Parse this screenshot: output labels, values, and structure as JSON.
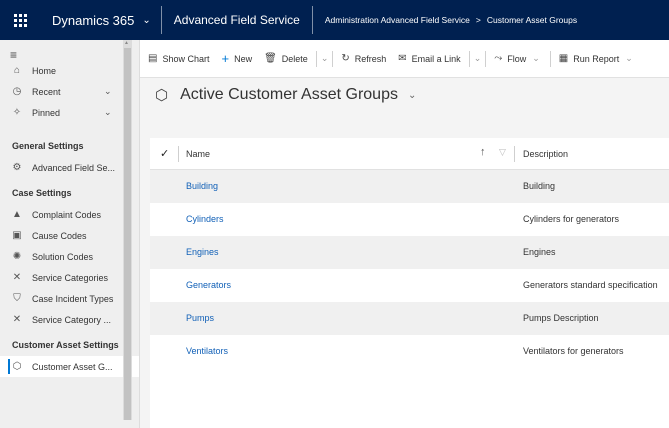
{
  "topbar": {
    "brand": "Dynamics 365",
    "brand_chevron": "⌄",
    "app_name": "Advanced Field Service",
    "breadcrumb": [
      "Administration Advanced Field Service",
      "Customer Asset Groups"
    ],
    "breadcrumb_separator": ">"
  },
  "command_bar": {
    "show_chart": "Show Chart",
    "new": "New",
    "delete": "Delete",
    "refresh": "Refresh",
    "email_link": "Email a Link",
    "flow": "Flow",
    "run_report": "Run Report"
  },
  "sidebar": {
    "nav": [
      {
        "label": "Home",
        "icon": "home-icon"
      },
      {
        "label": "Recent",
        "icon": "clock-icon"
      },
      {
        "label": "Pinned",
        "icon": "pin-icon"
      }
    ],
    "groups": [
      {
        "header": "General Settings",
        "items": [
          {
            "label": "Advanced Field Se...",
            "icon": "gear-icon"
          }
        ]
      },
      {
        "header": "Case Settings",
        "items": [
          {
            "label": "Complaint Codes",
            "icon": "warning-icon"
          },
          {
            "label": "Cause Codes",
            "icon": "clipboard-icon"
          },
          {
            "label": "Solution Codes",
            "icon": "lightbulb-icon"
          },
          {
            "label": "Service Categories",
            "icon": "tools-icon"
          },
          {
            "label": "Case Incident Types",
            "icon": "shield-icon"
          },
          {
            "label": "Service Category ...",
            "icon": "tools-icon"
          }
        ]
      },
      {
        "header": "Customer Asset Settings",
        "items": [
          {
            "label": "Customer Asset G...",
            "icon": "asset-group-icon",
            "active": true
          }
        ]
      }
    ]
  },
  "main": {
    "view_title": "Active Customer Asset Groups",
    "columns": {
      "name": "Name",
      "description": "Description"
    },
    "rows": [
      {
        "name": "Building",
        "description": "Building"
      },
      {
        "name": "Cylinders",
        "description": "Cylinders  for generators"
      },
      {
        "name": "Engines",
        "description": "Engines"
      },
      {
        "name": "Generators",
        "description": "Generators standard specification"
      },
      {
        "name": "Pumps",
        "description": "Pumps Description"
      },
      {
        "name": "Ventilators",
        "description": "Ventilators for generators"
      }
    ]
  },
  "colors": {
    "topbar": "#002050",
    "link": "#1160b7",
    "accent": "#0078d4"
  }
}
